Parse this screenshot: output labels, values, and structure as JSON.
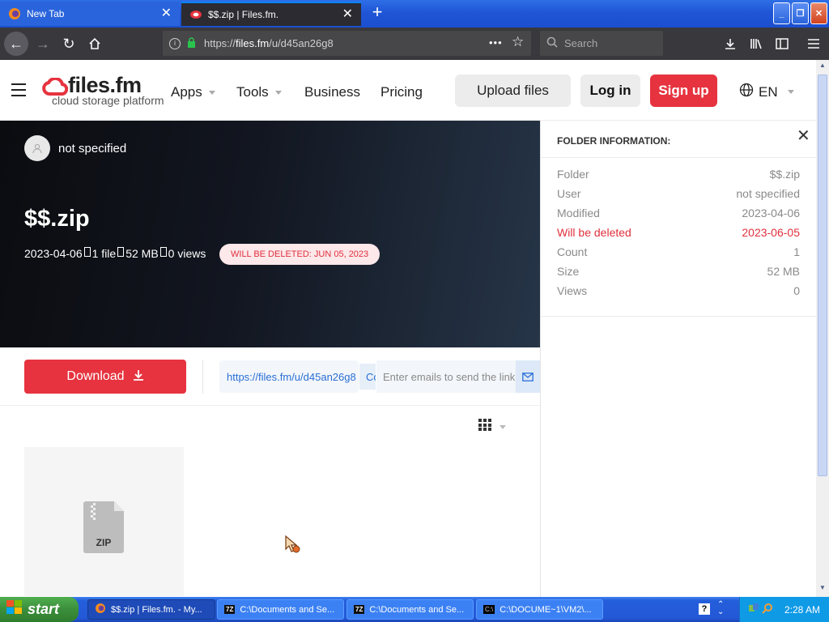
{
  "browser": {
    "tabs": [
      {
        "title": "New Tab",
        "active": false
      },
      {
        "title": "$$.zip | Files.fm.",
        "active": true
      }
    ],
    "url": "https://files.fm/u/d45an26g8",
    "url_prefix": "https://",
    "url_domain": "files.fm",
    "url_path": "/u/d45an26g8",
    "url_menu": "•••",
    "search_placeholder": "Search"
  },
  "header": {
    "logo_brand": "files.fm",
    "logo_tagline": "cloud storage platform",
    "nav": [
      "Apps",
      "Tools",
      "Business",
      "Pricing"
    ],
    "upload_label": "Upload files",
    "login_label": "Log in",
    "signup_label": "Sign up",
    "lang": "EN"
  },
  "hero": {
    "owner": "not specified",
    "title": "$$.zip",
    "date": "2023-04-06",
    "files": "1 file",
    "size": "52 MB",
    "views": "0 views",
    "delete_badge": "WILL BE DELETED: JUN 05, 2023"
  },
  "actions": {
    "download_label": "Download",
    "share_link": "https://files.fm/u/d45an26g8",
    "copy_label": "Co",
    "email_placeholder": "Enter emails to send the link"
  },
  "file": {
    "type_label": "ZIP"
  },
  "panel": {
    "title": "FOLDER INFORMATION:",
    "rows": [
      {
        "key": "Folder",
        "value": "$$.zip"
      },
      {
        "key": "User",
        "value": "not specified"
      },
      {
        "key": "Modified",
        "value": "2023-04-06"
      },
      {
        "key": "Will be deleted",
        "value": "2023-06-05"
      },
      {
        "key": "Count",
        "value": "1"
      },
      {
        "key": "Size",
        "value": "52 MB"
      },
      {
        "key": "Views",
        "value": "0"
      }
    ]
  },
  "taskbar": {
    "start_label": "start",
    "tasks": [
      "$$.zip | Files.fm. - My...",
      "C:\\Documents and Se...",
      "C:\\Documents and Se...",
      "C:\\DOCUME~1\\VM2\\..."
    ],
    "clock": "2:28 AM"
  },
  "colors": {
    "accent_red": "#e6333f",
    "link_blue": "#2a6fd6",
    "danger_text": "#e0303c"
  }
}
